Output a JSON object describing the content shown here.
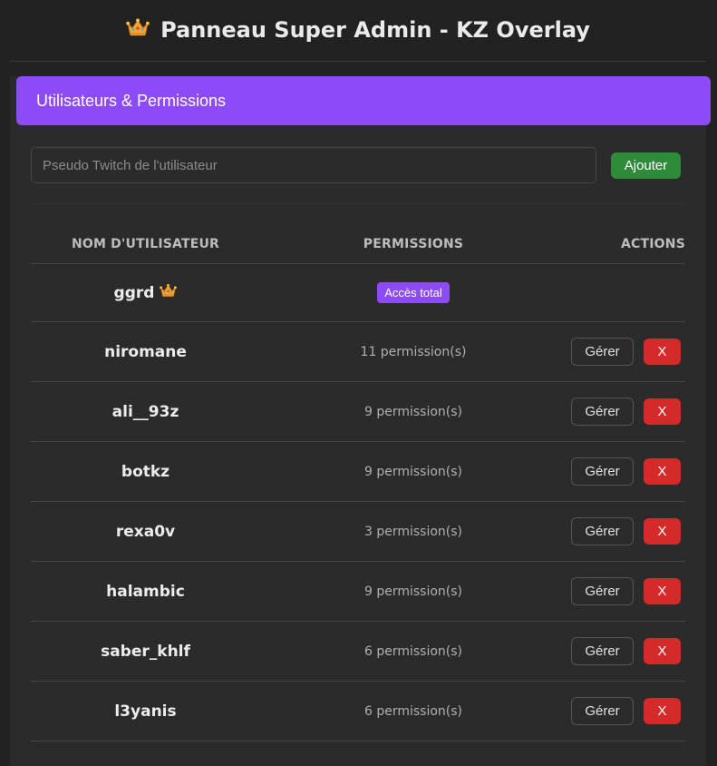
{
  "header": {
    "title": "Panneau Super Admin - KZ Overlay",
    "title_icon": "crown-icon"
  },
  "card": {
    "title": "Utilisateurs & Permissions",
    "accent_color": "#8c4bf7"
  },
  "add_user": {
    "placeholder": "Pseudo Twitch de l'utilisateur",
    "value": "",
    "button_label": "Ajouter"
  },
  "table": {
    "columns": [
      "NOM D'UTILISATEUR",
      "PERMISSIONS",
      "ACTIONS"
    ],
    "owner_row": {
      "username": "ggrd",
      "icon": "crown-icon",
      "permissions_badge": "Accès total"
    },
    "rows": [
      {
        "username": "niromane",
        "permissions": "11 permission(s)"
      },
      {
        "username": "ali__93z",
        "permissions": "9 permission(s)"
      },
      {
        "username": "botkz",
        "permissions": "9 permission(s)"
      },
      {
        "username": "rexa0v",
        "permissions": "3 permission(s)"
      },
      {
        "username": "halambic",
        "permissions": "9 permission(s)"
      },
      {
        "username": "saber_khlf",
        "permissions": "6 permission(s)"
      },
      {
        "username": "l3yanis",
        "permissions": "6 permission(s)"
      }
    ],
    "manage_label": "Gérer",
    "delete_label": "X"
  },
  "colors": {
    "background": "#222222",
    "panel": "#2b2b2b",
    "add_button": "#2e8b3a",
    "delete_button": "#d42a2a",
    "badge": "#8c4bf7"
  }
}
